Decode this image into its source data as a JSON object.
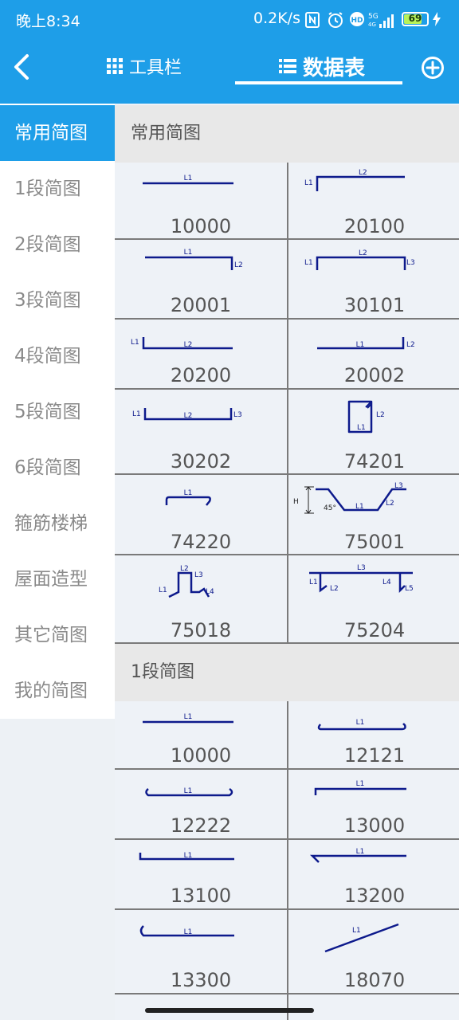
{
  "status_bar": {
    "time": "晚上8:34",
    "net_speed": "0.2K/s",
    "battery": "69",
    "icons": [
      "nfc-icon",
      "alarm-icon",
      "hd-icon",
      "signal-5g-icon",
      "battery-icon",
      "charging-icon"
    ]
  },
  "header": {
    "tabs": [
      {
        "label": "工具栏",
        "icon": "grid-icon"
      },
      {
        "label": "数据表",
        "icon": "list-icon",
        "active": true
      }
    ]
  },
  "sidebar": {
    "items": [
      {
        "label": "常用简图",
        "active": true
      },
      {
        "label": "1段简图"
      },
      {
        "label": "2段简图"
      },
      {
        "label": "3段简图"
      },
      {
        "label": "4段简图"
      },
      {
        "label": "5段简图"
      },
      {
        "label": "6段简图"
      },
      {
        "label": "箍筋楼梯"
      },
      {
        "label": "屋面造型"
      },
      {
        "label": "其它简图"
      },
      {
        "label": "我的简图"
      }
    ]
  },
  "sections": [
    {
      "title": "常用简图",
      "shapes": [
        {
          "code": "10000",
          "labels": [
            "L1"
          ]
        },
        {
          "code": "20100",
          "labels": [
            "L1",
            "L2"
          ]
        },
        {
          "code": "20001",
          "labels": [
            "L1",
            "L2"
          ]
        },
        {
          "code": "30101",
          "labels": [
            "L1",
            "L2",
            "L3"
          ]
        },
        {
          "code": "20200",
          "labels": [
            "L1",
            "L2"
          ]
        },
        {
          "code": "20002",
          "labels": [
            "L1",
            "L2"
          ]
        },
        {
          "code": "30202",
          "labels": [
            "L1",
            "L2",
            "L3"
          ]
        },
        {
          "code": "74201",
          "labels": [
            "L2",
            "L1"
          ]
        },
        {
          "code": "74220",
          "labels": [
            "L1"
          ]
        },
        {
          "code": "75001",
          "labels": [
            "H",
            "45°",
            "L1",
            "L2",
            "L3"
          ]
        },
        {
          "code": "75018",
          "labels": [
            "L2",
            "L3",
            "L1",
            "L4"
          ]
        },
        {
          "code": "75204",
          "labels": [
            "L3",
            "L1",
            "L2",
            "L4",
            "L5"
          ]
        }
      ]
    },
    {
      "title": "1段简图",
      "shapes": [
        {
          "code": "10000",
          "labels": [
            "L1"
          ]
        },
        {
          "code": "12121",
          "labels": [
            "L1"
          ]
        },
        {
          "code": "12222",
          "labels": [
            "L1"
          ]
        },
        {
          "code": "13000",
          "labels": [
            "L1"
          ]
        },
        {
          "code": "13100",
          "labels": [
            "L1"
          ]
        },
        {
          "code": "13200",
          "labels": [
            "L1"
          ]
        },
        {
          "code": "13300",
          "labels": [
            "L1"
          ]
        },
        {
          "code": "18070",
          "labels": [
            "L1"
          ]
        }
      ]
    }
  ],
  "colors": {
    "primary": "#1E9EE8",
    "shape_stroke": "#0D1A8C",
    "content_bg": "#EEF2F7",
    "section_bg": "#E8E8E8"
  }
}
